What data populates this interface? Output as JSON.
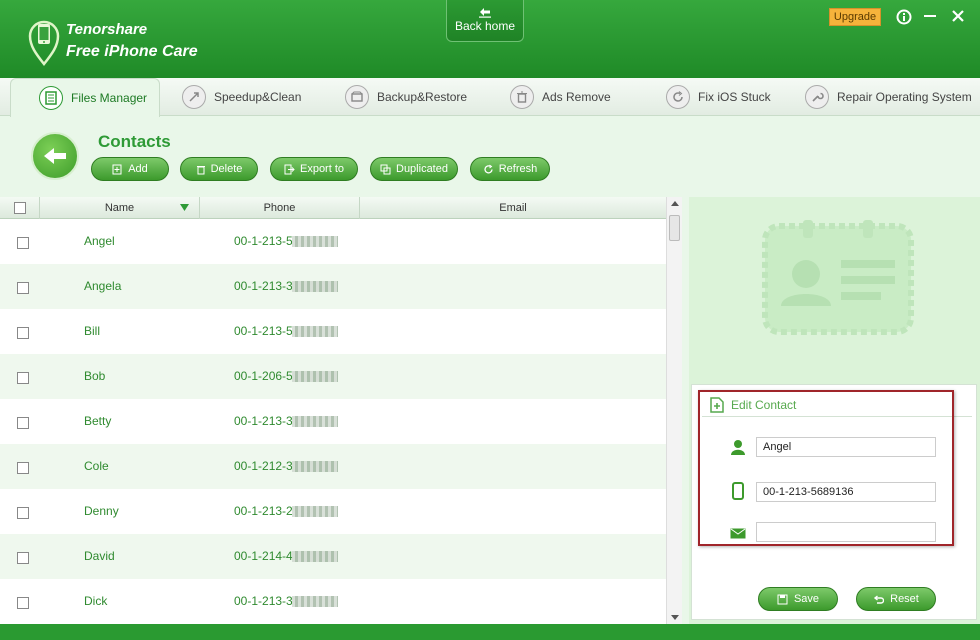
{
  "app": {
    "brand_line1": "Tenorshare",
    "brand_line2": "Free iPhone Care",
    "back_home": "Back home",
    "upgrade": "Upgrade"
  },
  "tabs": [
    {
      "label": "Files Manager",
      "icon": "files-icon",
      "active": true
    },
    {
      "label": "Speedup&Clean",
      "icon": "rocket-icon"
    },
    {
      "label": "Backup&Restore",
      "icon": "backup-icon"
    },
    {
      "label": "Ads Remove",
      "icon": "trash-icon"
    },
    {
      "label": "Fix iOS Stuck",
      "icon": "refresh-icon"
    },
    {
      "label": "Repair Operating System",
      "icon": "wrench-icon"
    }
  ],
  "section": {
    "title": "Contacts"
  },
  "toolbar": {
    "add": "Add",
    "delete": "Delete",
    "export": "Export to",
    "duplicated": "Duplicated",
    "refresh": "Refresh"
  },
  "table": {
    "headers": {
      "name": "Name",
      "phone": "Phone",
      "email": "Email"
    },
    "rows": [
      {
        "name": "Angel",
        "phone": "00-1-213-5"
      },
      {
        "name": "Angela",
        "phone": "00-1-213-3"
      },
      {
        "name": "Bill",
        "phone": "00-1-213-5"
      },
      {
        "name": "Bob",
        "phone": "00-1-206-5"
      },
      {
        "name": "Betty",
        "phone": "00-1-213-3"
      },
      {
        "name": "Cole",
        "phone": "00-1-212-3"
      },
      {
        "name": "Denny",
        "phone": "00-1-213-2"
      },
      {
        "name": "David",
        "phone": "00-1-214-4"
      },
      {
        "name": "Dick",
        "phone": "00-1-213-3"
      }
    ]
  },
  "edit": {
    "title": "Edit Contact",
    "name_value": "Angel",
    "phone_value": "00-1-213-5689136",
    "email_value": "",
    "save": "Save",
    "reset": "Reset"
  },
  "colors": {
    "brand_green": "#2a9a31",
    "accent": "#2e9a36",
    "highlight": "#a0252a",
    "upgrade": "#f6b33b"
  }
}
